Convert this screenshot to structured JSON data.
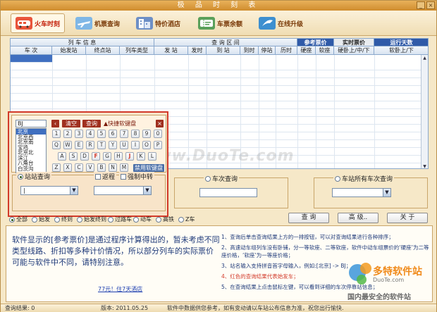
{
  "window": {
    "title": "极 品 时 刻 表"
  },
  "toolbar": {
    "items": [
      {
        "label": "火车时刻",
        "icon": "train-icon"
      },
      {
        "label": "机票查询",
        "icon": "plane-icon"
      },
      {
        "label": "特价酒店",
        "icon": "hotel-icon"
      },
      {
        "label": "车票余额",
        "icon": "ticket-icon"
      },
      {
        "label": "在线升级",
        "icon": "upgrade-icon"
      }
    ]
  },
  "table": {
    "group_headers": [
      "列 车 信 息",
      "查 询 区 间",
      "参考票价",
      "实时票价",
      "运行天数"
    ],
    "columns": [
      "车 次",
      "始发站",
      "终点站",
      "列车类型",
      "发 站",
      "发时",
      "到 站",
      "到时",
      "停站",
      "历时",
      "硬座",
      "软座",
      "硬卧上/中/下",
      "软卧上/下"
    ]
  },
  "keyboard": {
    "input_value": "BJ",
    "clear_label": "清空",
    "search_label": "查询",
    "fast_label": "▲快捷软键盘",
    "disable_label": "禁用软键盘",
    "stations": [
      "北京",
      "北京西",
      "北京南",
      "宝鸡",
      "北京北",
      "滨江",
      "八角台",
      "白茨沟"
    ],
    "row1": [
      "1",
      "2",
      "3",
      "4",
      "5",
      "6",
      "7",
      "8",
      "9",
      "0"
    ],
    "row2": [
      "Q",
      "W",
      "E",
      "R",
      "T",
      "Y",
      "U",
      "I",
      "O",
      "P"
    ],
    "row3": [
      "A",
      "S",
      "D",
      "F",
      "G",
      "H",
      "J",
      "K",
      "L"
    ],
    "row4": [
      "Z",
      "X",
      "C",
      "V",
      "B",
      "N",
      "M"
    ]
  },
  "search": {
    "station_label": "站站查询",
    "return_label": "返程",
    "transfer_label": "强制中转",
    "train_label": "车次查询",
    "station_all_label": "车站所有车次查询"
  },
  "filters": [
    "全部",
    "始发",
    "终到",
    "始发终到",
    "过路车",
    "动车",
    "高铁",
    "Z车"
  ],
  "buttons": {
    "query": "查 询",
    "advanced": "高 级..",
    "about": "关 于"
  },
  "info": {
    "main_text": "软件显示的[参考票价]是通过程序计算得出的，暂未考虑不同类型线路、折扣等多种计价情况，所以部分列车的实际票价可能与软件中不同，请特别注意。",
    "link_text": "77元！住7天酒店",
    "tips": [
      "1、查询后单击查询结果上方的一排按钮，可以对查询结果进行各种排序；",
      "2、高速动车组列车没有卧铺，分一等软座、二等软座，软件中动车组票价的‘硬座’为二等座价格，‘软座’为一等座价格；",
      "3、站名输入支持拼音首字母输入，例如:[北京] -> BJ；",
      "4、红色的查询结果代表始发车；",
      "5、在查询结果上点击鼠标左键，可以看到详细的车次停靠站信息；"
    ]
  },
  "watermark": "www.DuoTe.com",
  "logo": {
    "title": "多特软件站",
    "subtitle": "国内最安全的软件站",
    "domain": "DuoTe.com"
  },
  "status": {
    "result_label": "查询结果: 0",
    "version_label": "版本: 2011.05.25",
    "notice": "软件中数据供您参考，如有变动请以车站公布信息为准，祝您出行愉快."
  },
  "colors": {
    "accent": "#d23a2a",
    "header_blue": "#2f5aa8",
    "bg": "#f6e8c8"
  }
}
